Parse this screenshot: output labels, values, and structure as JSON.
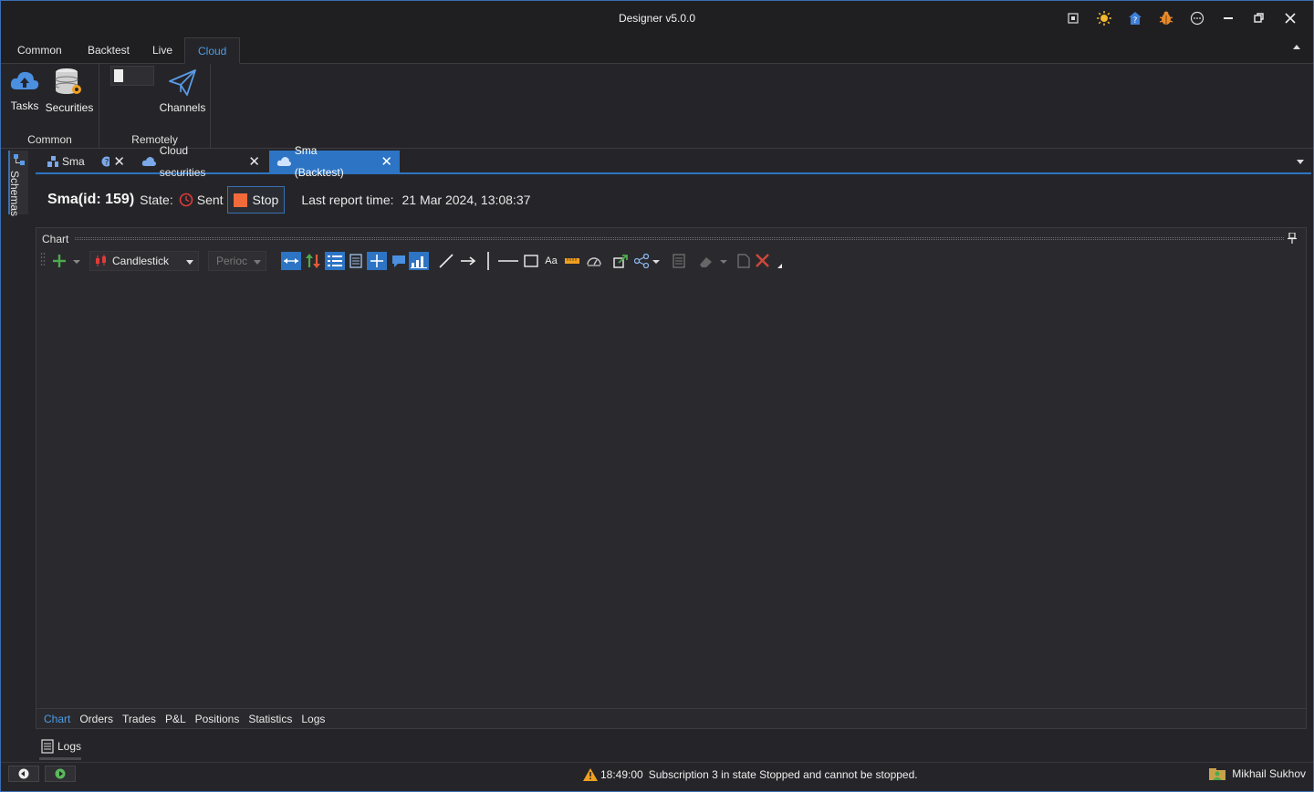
{
  "window": {
    "title": "Designer v5.0.0"
  },
  "ribbon": {
    "tabs": [
      {
        "label": "Common"
      },
      {
        "label": "Backtest"
      },
      {
        "label": "Live"
      },
      {
        "label": "Cloud"
      }
    ],
    "active_tab": "Cloud",
    "groups": [
      {
        "label": "Common",
        "buttons": [
          {
            "label": "Tasks"
          },
          {
            "label": "Securities"
          }
        ]
      },
      {
        "label": "Remotely",
        "buttons": [
          {
            "label": "Channels"
          }
        ]
      }
    ]
  },
  "sidebar": {
    "schemas_label": "Schemas"
  },
  "doc_tabs": [
    {
      "label": "Sma"
    },
    {
      "label": "Cloud securities"
    },
    {
      "label": "Sma (Backtest)"
    }
  ],
  "statebar": {
    "title": "Sma(id: 159)",
    "state_label": "State:",
    "state_value": "Sent",
    "stop_label": "Stop",
    "report_label": "Last report time:",
    "report_time": "21 Mar 2024, 13:08:37"
  },
  "chart": {
    "title": "Chart",
    "chart_type_value": "Candlestick",
    "period_placeholder": "Perioc",
    "aa_label": "Aa"
  },
  "bottom_tabs": [
    {
      "label": "Chart"
    },
    {
      "label": "Orders"
    },
    {
      "label": "Trades"
    },
    {
      "label": "P&L"
    },
    {
      "label": "Positions"
    },
    {
      "label": "Statistics"
    },
    {
      "label": "Logs"
    }
  ],
  "logs_panel": {
    "label": "Logs"
  },
  "status": {
    "time": "18:49:00",
    "message": "Subscription 3 in state Stopped and cannot be stopped.",
    "user": "Mikhail Sukhov"
  },
  "colors": {
    "accent": "#2d74c4",
    "stop": "#f06a3a",
    "warning": "#f0a020"
  }
}
